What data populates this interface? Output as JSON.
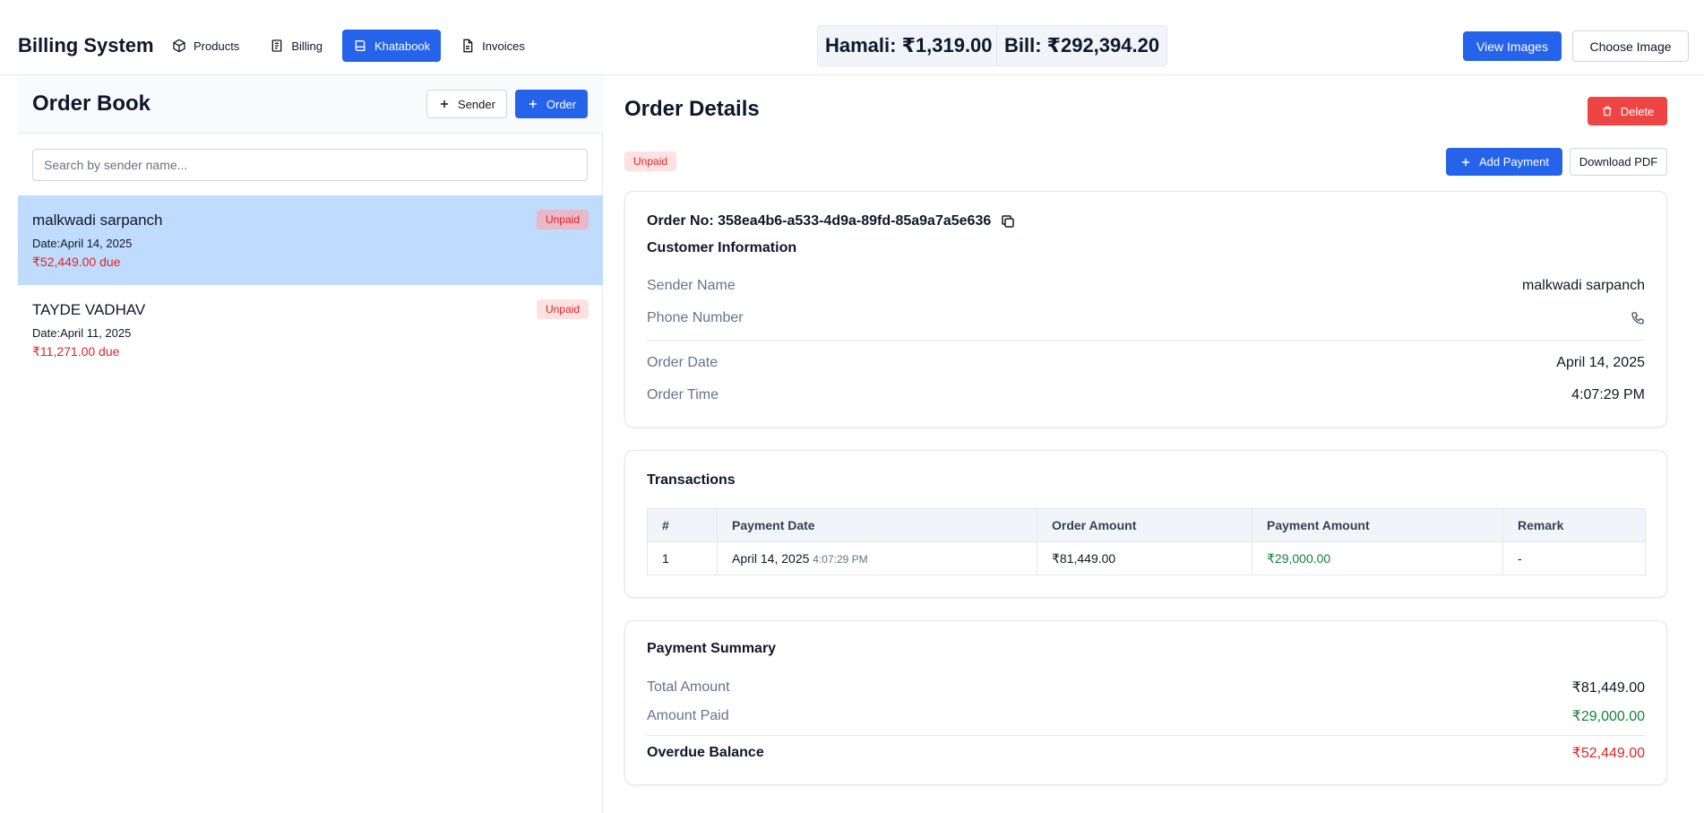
{
  "app": {
    "title": "Billing System"
  },
  "nav": [
    {
      "label": "Products",
      "icon": "box-icon",
      "active": false
    },
    {
      "label": "Billing",
      "icon": "receipt-icon",
      "active": false
    },
    {
      "label": "Khatabook",
      "icon": "book-icon",
      "active": true
    },
    {
      "label": "Invoices",
      "icon": "file-icon",
      "active": false
    }
  ],
  "stats": {
    "hamali": "Hamali: ₹1,319.00",
    "bill": "Bill: ₹292,394.20"
  },
  "header_actions": {
    "view_images": "View Images",
    "choose_image": "Choose Image"
  },
  "order_book": {
    "title": "Order Book",
    "sender_button": "Sender",
    "order_button": "Order",
    "search_placeholder": "Search by sender name...",
    "orders": [
      {
        "name": "malkwadi sarpanch",
        "date": "Date:April 14, 2025",
        "due": "₹52,449.00 due",
        "status": "Unpaid",
        "selected": true
      },
      {
        "name": "TAYDE VADHAV",
        "date": "Date:April 11, 2025",
        "due": "₹11,271.00 due",
        "status": "Unpaid",
        "selected": false
      }
    ]
  },
  "order_details": {
    "title": "Order Details",
    "delete_label": "Delete",
    "status": "Unpaid",
    "add_payment_label": "Add Payment",
    "download_pdf_label": "Download PDF",
    "order_no": "Order No: 358ea4b6-a533-4d9a-89fd-85a9a7a5e636",
    "customer_info_title": "Customer Information",
    "sender_name_label": "Sender Name",
    "sender_name": "malkwadi sarpanch",
    "phone_label": "Phone Number",
    "order_date_label": "Order Date",
    "order_date": "April 14, 2025",
    "order_time_label": "Order Time",
    "order_time": "4:07:29 PM"
  },
  "transactions": {
    "title": "Transactions",
    "columns": [
      "#",
      "Payment Date",
      "Order Amount",
      "Payment Amount",
      "Remark"
    ],
    "rows": [
      {
        "num": "1",
        "date": "April 14, 2025",
        "time": "4:07:29 PM",
        "order_amount": "₹81,449.00",
        "payment_amount": "₹29,000.00",
        "remark": "-"
      }
    ]
  },
  "payment_summary": {
    "title": "Payment Summary",
    "total_label": "Total Amount",
    "total": "₹81,449.00",
    "paid_label": "Amount Paid",
    "paid": "₹29,000.00",
    "overdue_label": "Overdue Balance",
    "overdue": "₹52,449.00"
  },
  "colors": {
    "primary": "#2563eb",
    "danger": "#ef4444",
    "selected_row": "#bfdbfe",
    "paid_green": "#15803d",
    "due_red": "#dc2626"
  }
}
